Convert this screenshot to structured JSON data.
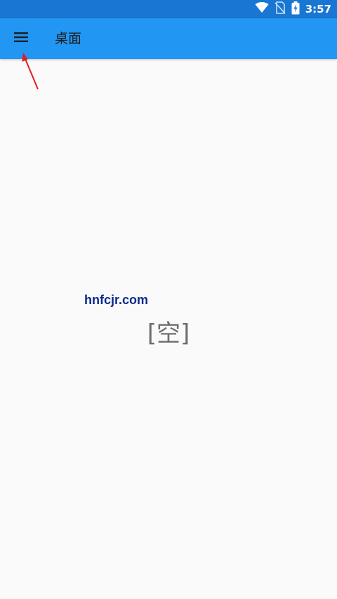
{
  "status_bar": {
    "time": "3:57",
    "icons": [
      "wifi-icon",
      "no-sim-icon",
      "battery-charging-icon"
    ],
    "color": "#1976d2"
  },
  "app_bar": {
    "menu_icon": "hamburger-menu-icon",
    "title": "桌面",
    "color": "#2196f3"
  },
  "annotation": {
    "arrow_color": "#e01e1e"
  },
  "watermark": {
    "text": "hnfcjr.com"
  },
  "content": {
    "empty_label": "[空]"
  }
}
